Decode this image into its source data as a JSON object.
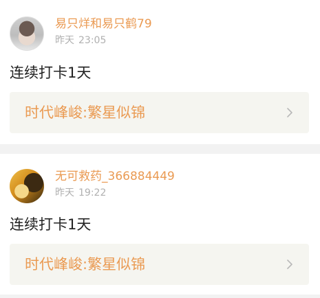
{
  "posts": [
    {
      "author": "易只烊和易只鹤79",
      "time_day": "昨天",
      "time_clock": "23:05",
      "text": "连续打卡1天",
      "topic": "时代峰峻:繁星似锦",
      "avatar_icon": "user-avatar-photo"
    },
    {
      "author": "无可救药_366884449",
      "time_day": "昨天",
      "time_clock": "19:22",
      "text": "连续打卡1天",
      "topic": "时代峰峻:繁星似锦",
      "avatar_icon": "user-avatar-photo"
    }
  ],
  "colors": {
    "accent": "#ea9a52",
    "muted": "#b0b0b0",
    "card_bg": "#f5f5f0",
    "separator": "#f2f2f2"
  },
  "icons": {
    "chevron": "chevron-right-icon"
  }
}
